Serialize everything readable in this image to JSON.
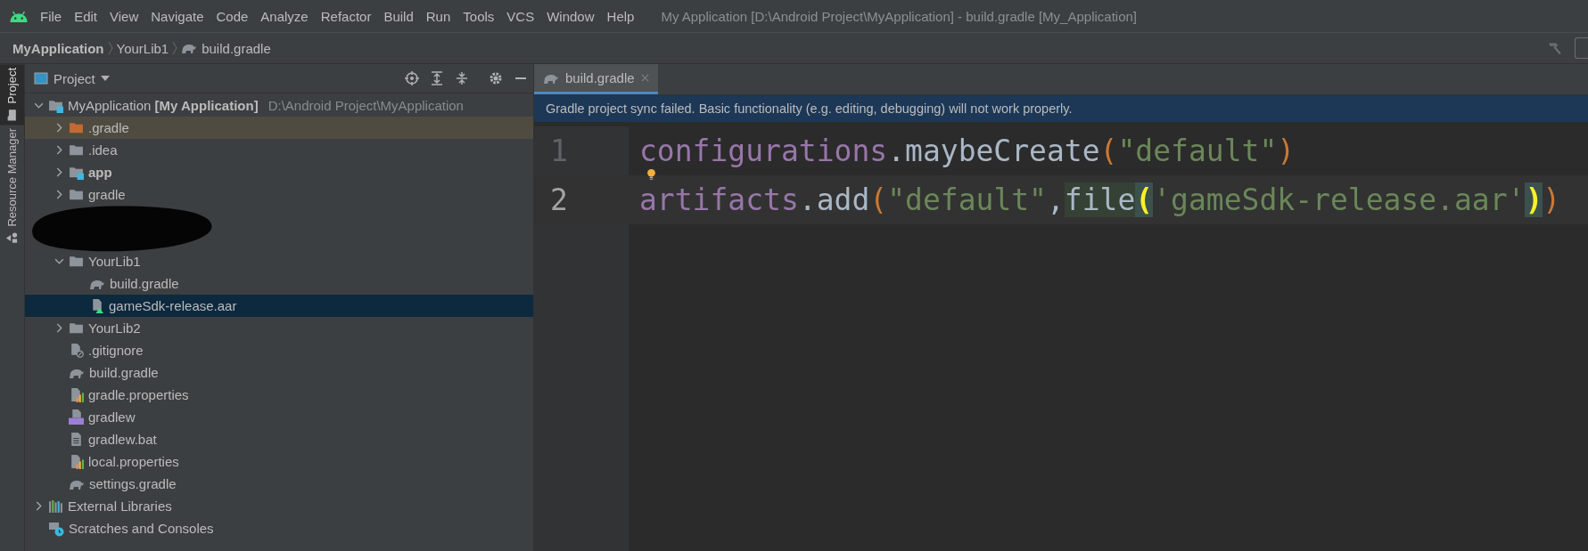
{
  "menu_bar": {
    "items": [
      {
        "label": "File"
      },
      {
        "label": "Edit"
      },
      {
        "label": "View"
      },
      {
        "label": "Navigate"
      },
      {
        "label": "Code"
      },
      {
        "label": "Analyze"
      },
      {
        "label": "Refactor"
      },
      {
        "label": "Build"
      },
      {
        "label": "Run"
      },
      {
        "label": "Tools"
      },
      {
        "label": "VCS"
      },
      {
        "label": "Window"
      },
      {
        "label": "Help"
      }
    ],
    "window_title": "My Application [D:\\Android Project\\MyApplication] - build.gradle [My_Application]"
  },
  "breadcrumbs": [
    {
      "label": "MyApplication",
      "kind": "project"
    },
    {
      "label": "YourLib1",
      "kind": "folder"
    },
    {
      "label": "build.gradle",
      "kind": "gradle"
    }
  ],
  "side_stripe": [
    {
      "label": "Project",
      "selected": true
    },
    {
      "label": "Resource Manager",
      "selected": false
    }
  ],
  "project_panel": {
    "title": "Project",
    "tree": [
      {
        "label": "MyApplication",
        "module": "[My Application]",
        "path": "D:\\Android Project\\MyApplication",
        "kind": "module-folder",
        "expanded": true,
        "selected": false,
        "children": [
          {
            "label": ".gradle",
            "kind": "excluded-folder",
            "expanded": false,
            "selected": false
          },
          {
            "label": ".idea",
            "kind": "folder",
            "expanded": false,
            "selected": false
          },
          {
            "label": "app",
            "kind": "module-folder",
            "expanded": false,
            "selected": false
          },
          {
            "label": "gradle",
            "kind": "folder",
            "expanded": false,
            "selected": false
          },
          {
            "kind": "redacted"
          },
          {
            "label": "YourLib1",
            "kind": "folder",
            "expanded": true,
            "selected": false,
            "children": [
              {
                "label": "build.gradle",
                "kind": "gradle",
                "selected": false
              },
              {
                "label": "gameSdk-release.aar",
                "kind": "archive",
                "selected": true
              }
            ]
          },
          {
            "label": "YourLib2",
            "kind": "folder",
            "expanded": false,
            "selected": false
          },
          {
            "label": ".gitignore",
            "kind": "ignore-file",
            "selected": false
          },
          {
            "label": "build.gradle",
            "kind": "gradle",
            "selected": false
          },
          {
            "label": "gradle.properties",
            "kind": "properties",
            "selected": false
          },
          {
            "label": "gradlew",
            "kind": "shell-script",
            "selected": false
          },
          {
            "label": "gradlew.bat",
            "kind": "text-file",
            "selected": false
          },
          {
            "label": "local.properties",
            "kind": "properties",
            "selected": false
          },
          {
            "label": "settings.gradle",
            "kind": "gradle",
            "selected": false
          }
        ]
      },
      {
        "label": "External Libraries",
        "kind": "libraries",
        "expanded": false,
        "selected": false
      },
      {
        "label": "Scratches and Consoles",
        "kind": "scratches",
        "selected": false
      }
    ]
  },
  "editor": {
    "tabs": [
      {
        "label": "build.gradle",
        "selected": true
      }
    ],
    "banner": "Gradle project sync failed. Basic functionality (e.g. editing, debugging) will not work properly.",
    "lines": [
      {
        "number": "1",
        "current": false,
        "tokens": [
          {
            "text": "configurations",
            "kind": "field"
          },
          {
            "text": ".",
            "kind": "plain"
          },
          {
            "text": "maybeCreate",
            "kind": "method"
          },
          {
            "text": "(",
            "kind": "paren"
          },
          {
            "text": "\"default\"",
            "kind": "string"
          },
          {
            "text": ")",
            "kind": "paren"
          }
        ]
      },
      {
        "number": "2",
        "current": true,
        "tokens": [
          {
            "text": "artifacts",
            "kind": "field"
          },
          {
            "text": ".",
            "kind": "plain"
          },
          {
            "text": "add",
            "kind": "method"
          },
          {
            "text": "(",
            "kind": "paren"
          },
          {
            "text": "\"default\"",
            "kind": "string"
          },
          {
            "text": ",",
            "kind": "plain"
          },
          {
            "text": "file",
            "kind": "usage"
          },
          {
            "text": "(",
            "kind": "paren-match"
          },
          {
            "text": "'gameSdk-release.aar'",
            "kind": "string"
          },
          {
            "text": ")",
            "kind": "paren-match"
          },
          {
            "text": ")",
            "kind": "paren"
          }
        ]
      }
    ]
  }
}
